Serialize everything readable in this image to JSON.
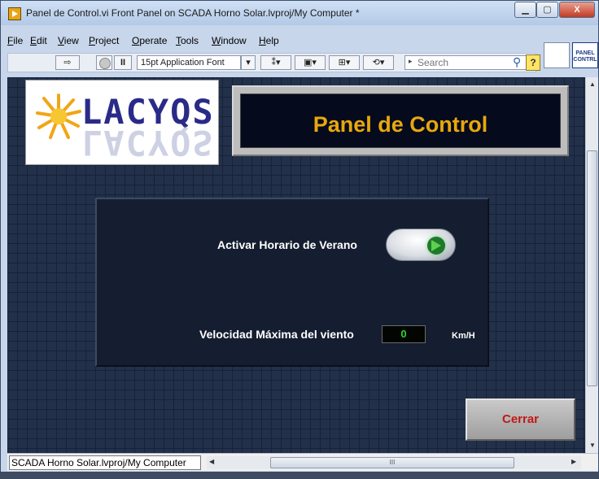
{
  "window": {
    "title": "Panel de Control.vi Front Panel on SCADA Horno Solar.lvproj/My Computer *",
    "minimize": "▁",
    "maximize": "▢",
    "close": "X"
  },
  "menu": [
    "File",
    "Edit",
    "View",
    "Project",
    "Operate",
    "Tools",
    "Window",
    "Help"
  ],
  "toolbar": {
    "run": "⇨",
    "pause": "II",
    "font": "15pt Application Font",
    "font_dropdown": "▾",
    "align_tool": "⁑▾",
    "distribute_tool": "▣▾",
    "resize_tool": "⊞▾",
    "reorder_tool": "⟲▾",
    "search_placeholder": "Search",
    "help": "?",
    "vi_icon_text": "PANEL CONTRL"
  },
  "panel": {
    "logo_text": "LACYQS",
    "title": "Panel de Control",
    "dst_label": "Activar Horario de Verano",
    "dst_state": "on",
    "wind_label": "Velocidad Máxima del viento",
    "wind_value": "0",
    "wind_unit": "Km/H",
    "close_button": "Cerrar"
  },
  "statusbar": {
    "project_path": "SCADA Horno Solar.lvproj/My Computer",
    "hscroll_grip": "III"
  },
  "colors": {
    "canvas": "#22304a",
    "title_text": "#e8a80d",
    "close_text": "#c41717",
    "indicator_text": "#2fd12f"
  }
}
